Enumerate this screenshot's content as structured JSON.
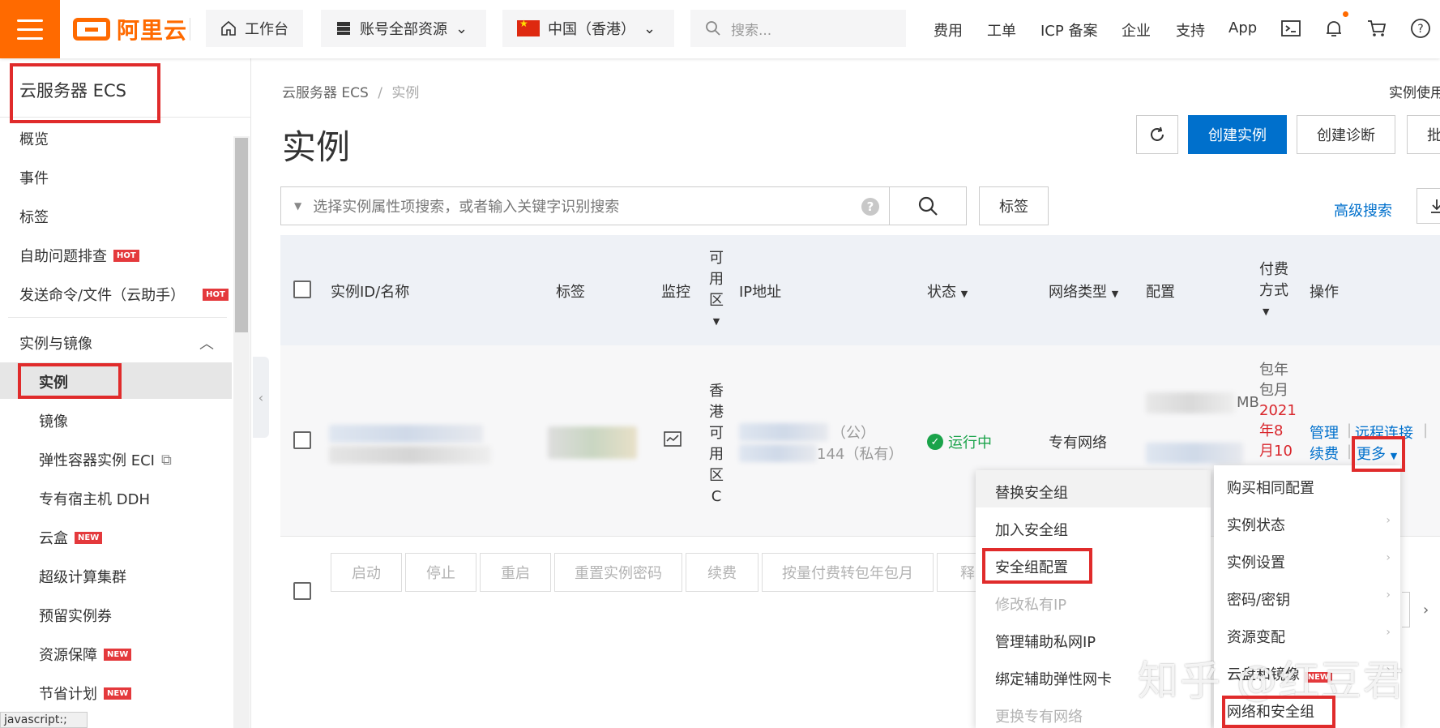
{
  "topbar": {
    "logo_text": "阿里云",
    "workbench": "工作台",
    "resource_scope": "账号全部资源",
    "region": "中国（香港）",
    "search_placeholder": "搜索...",
    "links": [
      "费用",
      "工单",
      "ICP 备案",
      "企业",
      "支持",
      "App"
    ],
    "icons": [
      "terminal-icon",
      "bell-icon",
      "cart-icon",
      "help-icon"
    ],
    "accent_color": "#ff6a00"
  },
  "sidebar": {
    "title": "云服务器 ECS",
    "items": [
      {
        "label": "概览"
      },
      {
        "label": "事件"
      },
      {
        "label": "标签"
      },
      {
        "label": "自助问题排查",
        "badge": "HOT"
      },
      {
        "label": "发送命令/文件（云助手）",
        "badge": "HOT"
      }
    ],
    "section": "实例与镜像",
    "sub_items": [
      {
        "label": "实例"
      },
      {
        "label": "镜像"
      },
      {
        "label": "弹性容器实例 ECI"
      },
      {
        "label": "专有宿主机 DDH"
      },
      {
        "label": "云盒",
        "badge": "NEW"
      },
      {
        "label": "超级计算集群"
      },
      {
        "label": "预留实例券"
      },
      {
        "label": "资源保障",
        "badge": "NEW"
      },
      {
        "label": "节省计划",
        "badge": "NEW"
      }
    ],
    "status_tip": "javascript:;"
  },
  "main": {
    "breadcrumb_root": "云服务器 ECS",
    "breadcrumb_sep": "/",
    "breadcrumb_current": "实例",
    "page_title": "实例",
    "top_right_link": "实例使用",
    "create_instance": "创建实例",
    "create_diagnosis": "创建诊断",
    "batch_partial": "批",
    "search_placeholder": "选择实例属性项搜索，或者输入关键字识别搜索",
    "tags_button": "标签",
    "advanced_search": "高级搜索",
    "primary_color": "#0070cc"
  },
  "table": {
    "headers": {
      "id_name": "实例ID/名称",
      "tags": "标签",
      "monitor": "监控",
      "zone": [
        "可",
        "用",
        "区"
      ],
      "ip": "IP地址",
      "status": "状态",
      "network": "网络类型",
      "config": "配置",
      "billing": [
        "付费",
        "方式"
      ],
      "actions": "操作"
    },
    "row": {
      "zone": [
        "香",
        "港",
        "可",
        "用",
        "区",
        "C"
      ],
      "ip_public_suffix": "（公）",
      "ip_private_partial": "144（私有）",
      "status": "运行中",
      "network": "专有网络",
      "config_partial": "MB",
      "billing": [
        "包年",
        "包月"
      ],
      "expiry": [
        "2021",
        "年8",
        "月10"
      ],
      "action_manage": "管理",
      "action_remote": "远程连接",
      "action_renew": "续费",
      "action_more": "更多"
    }
  },
  "batch_actions": [
    "启动",
    "停止",
    "重启",
    "重置实例密码",
    "续费",
    "按量付费转包年包月",
    "释"
  ],
  "more_menu": {
    "items": [
      {
        "label": "购买相同配置",
        "has_sub": false
      },
      {
        "label": "实例状态",
        "has_sub": true
      },
      {
        "label": "实例设置",
        "has_sub": true
      },
      {
        "label": "密码/密钥",
        "has_sub": true
      },
      {
        "label": "资源变配",
        "has_sub": true
      },
      {
        "label": "云盘和镜像",
        "has_sub": true,
        "badge": "NEW"
      },
      {
        "label": "网络和安全组",
        "has_sub": false
      }
    ]
  },
  "network_submenu": {
    "items": [
      {
        "label": "替换安全组",
        "disabled": false
      },
      {
        "label": "加入安全组",
        "disabled": false
      },
      {
        "label": "安全组配置",
        "disabled": false
      },
      {
        "label": "修改私有IP",
        "disabled": true
      },
      {
        "label": "管理辅助私网IP",
        "disabled": false
      },
      {
        "label": "绑定辅助弹性网卡",
        "disabled": false
      },
      {
        "label": "更换专有网络",
        "disabled": true
      }
    ]
  },
  "watermark": "知乎 @红豆君",
  "highlight_color": "#e02b2b"
}
